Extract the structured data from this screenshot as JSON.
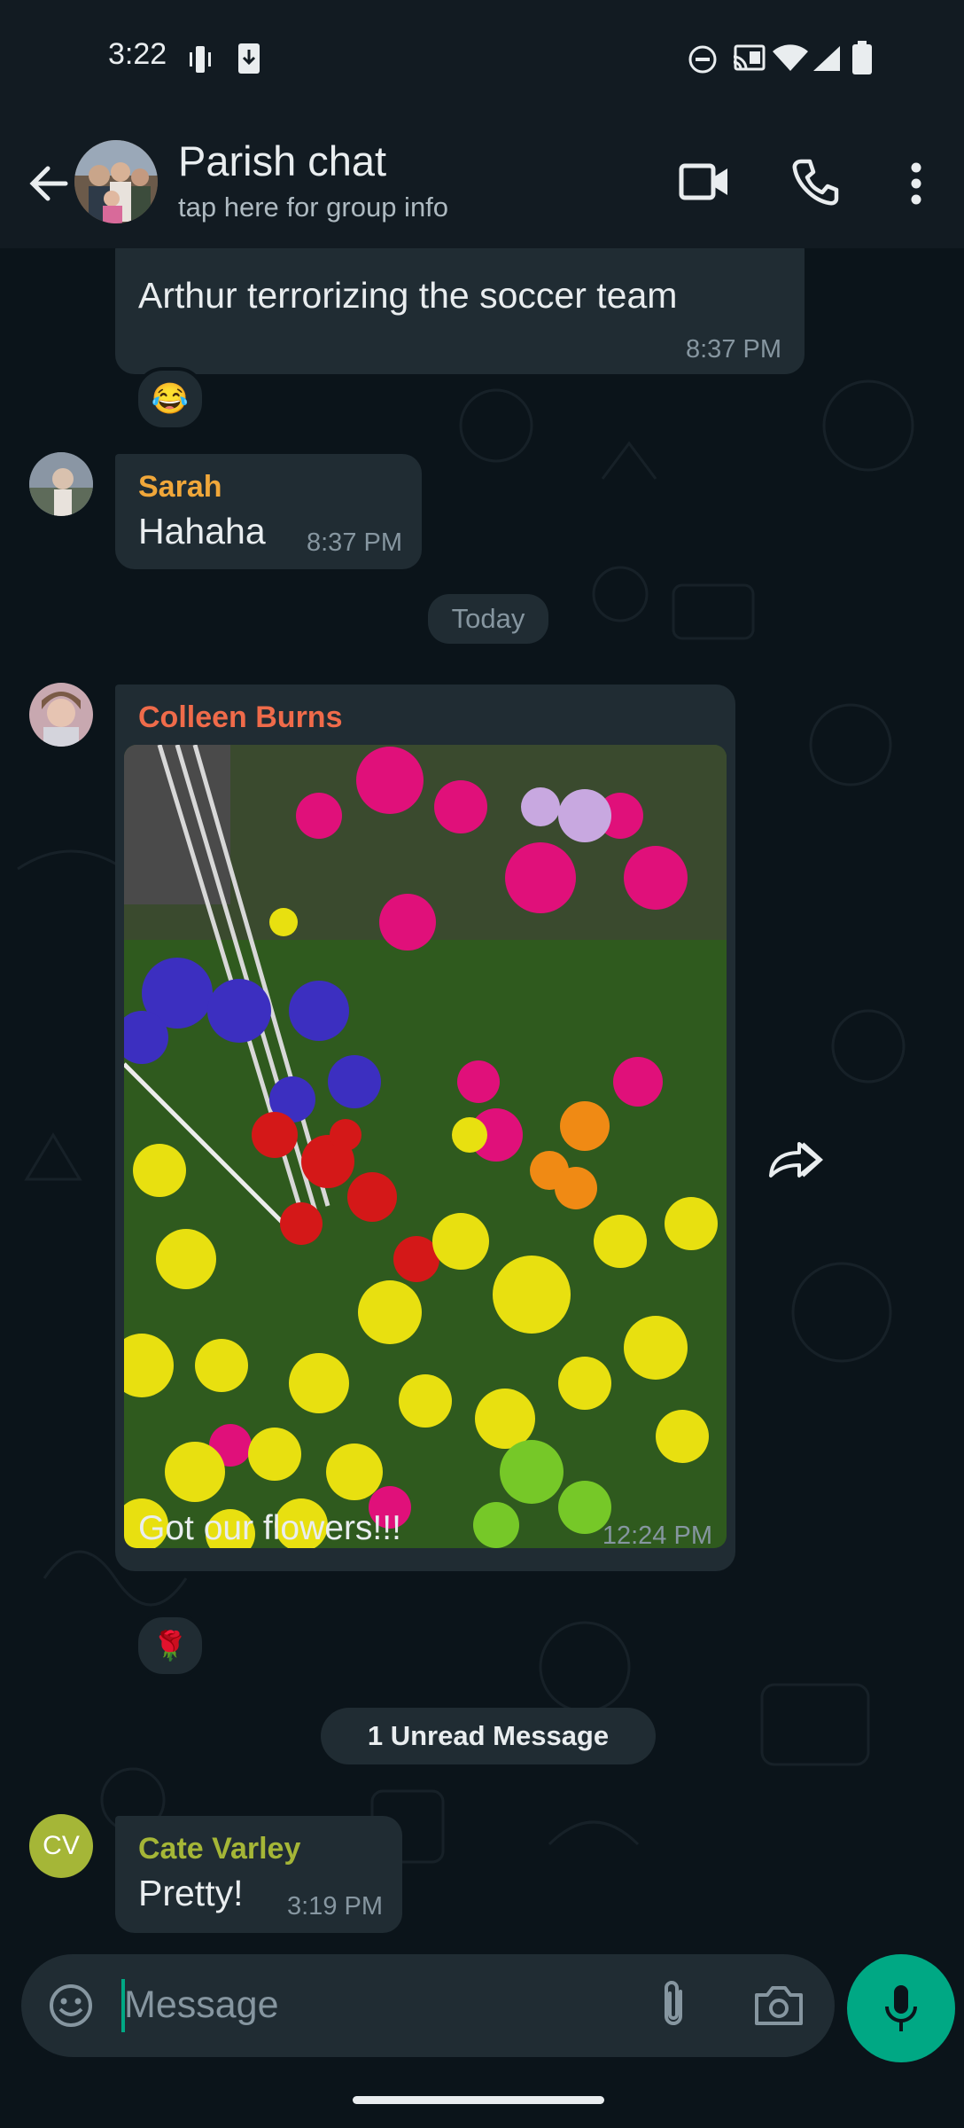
{
  "status_bar": {
    "time": "3:22"
  },
  "header": {
    "group_name": "Parish chat",
    "subtitle": "tap here for group info"
  },
  "messages": [
    {
      "type": "caption_partial",
      "text": "Arthur terrorizing the soccer team",
      "time": "8:37 PM",
      "reaction": "😂"
    },
    {
      "type": "text",
      "sender": "Sarah",
      "text": "Hahaha",
      "time": "8:37 PM"
    },
    {
      "type": "date_divider",
      "text": "Today"
    },
    {
      "type": "image",
      "sender": "Colleen Burns",
      "caption": "Got our flowers!!!",
      "time": "12:24 PM",
      "reaction": "🌹"
    },
    {
      "type": "unread_divider",
      "text": "1 Unread Message"
    },
    {
      "type": "text",
      "sender": "Cate Varley",
      "avatar_initials": "CV",
      "text": "Pretty!",
      "time": "3:19 PM"
    }
  ],
  "composer": {
    "placeholder": "Message"
  },
  "colors": {
    "accent": "#00a884",
    "sarah": "#f0a73a",
    "colleen": "#ef6b4a",
    "cate": "#a5b637",
    "bubble": "#202c33",
    "background": "#0b141a"
  }
}
